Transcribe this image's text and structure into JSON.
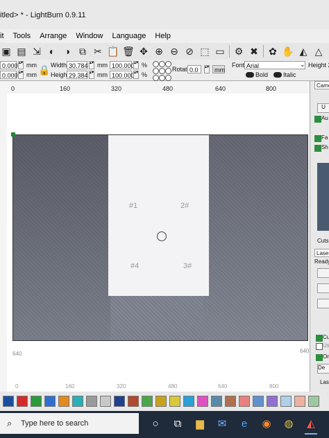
{
  "window": {
    "title": "itled> * - LightBurn 0.9.11"
  },
  "menu": [
    "it",
    "Tools",
    "Arrange",
    "Window",
    "Language",
    "Help"
  ],
  "toolbar_icons": [
    "save-icon",
    "export-icon",
    "import-icon",
    "undo-icon",
    "redo-icon",
    "copy-icon",
    "cut-icon",
    "paste-icon",
    "delete-icon",
    "move-icon",
    "zoom-in-icon",
    "zoom-out-icon",
    "zoom-frame-icon",
    "zoom-selection-icon",
    "monitor-icon",
    "settings-icon",
    "tools-icon",
    "users-icon",
    "hand-icon",
    "mirror-icon",
    "warning-icon"
  ],
  "properties": {
    "x_value": "0.000",
    "y_value": "0.000",
    "x_unit": "mm",
    "y_unit": "mm",
    "width_label": "Width",
    "width_value": "30.784",
    "height_label": "Height",
    "height_value": "29.384",
    "width_unit": "mm",
    "height_unit": "mm",
    "scale_w": "100.000",
    "scale_h": "100.000",
    "percent": "%",
    "rotate_label": "Rotate",
    "rotate_value": "0.0",
    "mm_button": "mm",
    "font_label": "Font",
    "font_value": "Arial",
    "bold_label": "Bold",
    "italic_label": "Italic",
    "height2_label": "Height 2."
  },
  "ruler_top": [
    "0",
    "160",
    "320",
    "480",
    "640",
    "800"
  ],
  "ruler_bottom": [
    "0",
    "160",
    "320",
    "480",
    "640",
    "800"
  ],
  "workspace_labels": {
    "left_640": "640",
    "right_640": "640",
    "left_0": "0"
  },
  "canvas_marks": [
    "#1",
    "2#",
    "#4",
    "3#"
  ],
  "right_panel": {
    "tab": "Came",
    "update_button": "U",
    "auto_label": "Au",
    "fade_label": "Fa",
    "show_label": "Sh",
    "cuts_label": "Cuts",
    "laser_label": "Laser",
    "ready_label": "Ready",
    "cut_label": "Cu",
    "use_label": "Us",
    "origin_label": "Or",
    "dev_label": "De",
    "laser2_label": "Lase"
  },
  "palette": [
    "#1a4fa0",
    "#d42a2a",
    "#2a9a3a",
    "#2f6fd0",
    "#e28a1c",
    "#27b0b8",
    "#9a9a9a",
    "#c8c8c8",
    "#1f3f8f",
    "#b04a2a",
    "#4aa84a",
    "#c8a21c",
    "#d8c83a",
    "#2aa0d8",
    "#e050c0",
    "#5a8aa8",
    "#b07050",
    "#e88080",
    "#6090d0",
    "#9070d0",
    "#b0d0e8",
    "#f0b0a0",
    "#a0c8a0"
  ],
  "taskbar": {
    "search_placeholder": "Type here to search"
  }
}
